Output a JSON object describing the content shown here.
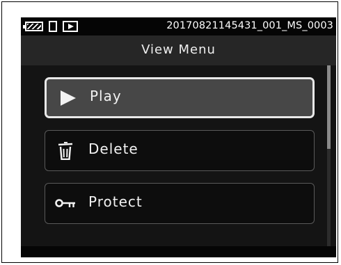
{
  "status_bar": {
    "icons": [
      "memory-card-icon",
      "document-icon",
      "playback-mode-icon"
    ],
    "filename": "20170821145431_001_MS_0003"
  },
  "header": {
    "title": "View Menu"
  },
  "menu": {
    "items": [
      {
        "label": "Play",
        "icon": "play-icon",
        "selected": true
      },
      {
        "label": "Delete",
        "icon": "trash-icon",
        "selected": false
      },
      {
        "label": "Protect",
        "icon": "key-icon",
        "selected": false
      }
    ]
  },
  "colors": {
    "screen_bg": "#1b1b1b",
    "header_bg": "#262626",
    "selected_item_bg": "#474747",
    "item_bg": "#0d0d0d",
    "text": "#f2f2f2"
  }
}
